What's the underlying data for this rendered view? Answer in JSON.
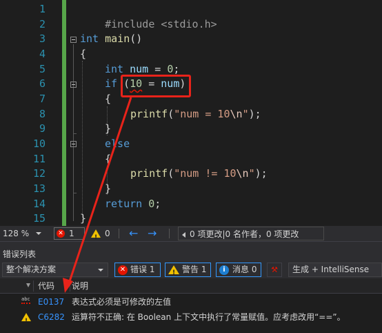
{
  "editor": {
    "line_numbers": [
      "1",
      "2",
      "3",
      "4",
      "5",
      "6",
      "7",
      "8",
      "9",
      "10",
      "11",
      "12",
      "13",
      "14",
      "15"
    ],
    "code": {
      "l1_pre": "#include <stdio.h>",
      "l3_kw": "int",
      "l3_fn": "main",
      "l3_rest": "()",
      "l4": "{",
      "l5_kw": "int",
      "l5_id": "num",
      "l5_op": " = ",
      "l5_num": "0",
      "l5_end": ";",
      "l6_kw": "if",
      "l6_open": " (",
      "l6_num": "10",
      "l6_op": " = ",
      "l6_id": "num",
      "l6_close": ")",
      "l7": "{",
      "l8_fn": "printf",
      "l8_open": "(",
      "l8_str1": "\"num = 10",
      "l8_esc": "\\n",
      "l8_str2": "\"",
      "l8_close": ");",
      "l9": "}",
      "l10_kw": "else",
      "l11": "{",
      "l12_fn": "printf",
      "l12_open": "(",
      "l12_str1": "\"num != 10",
      "l12_esc": "\\n",
      "l12_str2": "\"",
      "l12_close": ");",
      "l13": "}",
      "l14_kw": "return",
      "l14_num": "0",
      "l14_end": ";",
      "l15": "}"
    }
  },
  "status": {
    "zoom": "128 %",
    "errors": "1",
    "warnings": "0",
    "nav_back": "←",
    "nav_forward": "→",
    "changes_text": "0 项更改|0 名作者，0 项更改"
  },
  "error_list": {
    "title": "错误列表",
    "scope": "整个解决方案",
    "errors_btn": "错误 1",
    "warnings_btn": "警告 1",
    "messages_btn": "消息 0",
    "build_filter": "生成 + IntelliSense",
    "columns": {
      "code": "代码",
      "description": "说明"
    },
    "rows": [
      {
        "icon": "spelling-error-icon",
        "code": "E0137",
        "description": "表达式必须是可修改的左值"
      },
      {
        "icon": "warning-icon",
        "code": "C6282",
        "description": "运算符不正确: 在 Boolean 上下文中执行了常量赋值。应考虑改用“==”。"
      }
    ]
  },
  "colors": {
    "accent": "#3794ff",
    "error": "#e51400",
    "warning": "#f0c000",
    "annotation": "#e8231a",
    "changebar": "#57a64a"
  }
}
